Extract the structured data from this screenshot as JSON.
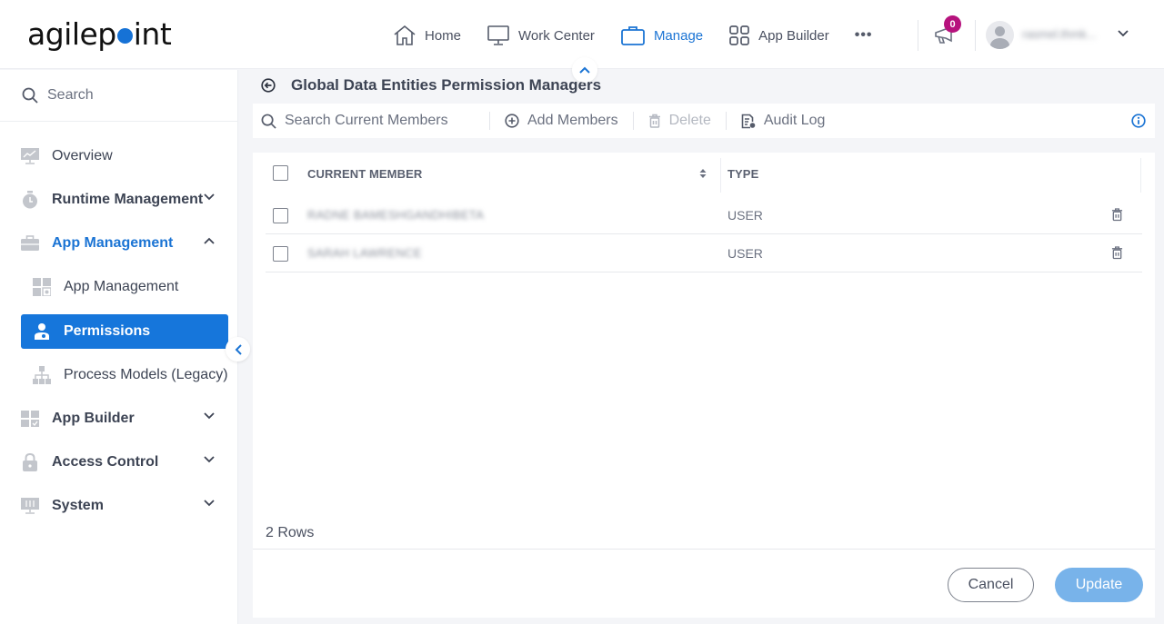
{
  "header": {
    "logo_prefix": "agilep",
    "logo_suffix": "int",
    "nav": [
      {
        "label": "Home",
        "icon": "home-icon",
        "active": false
      },
      {
        "label": "Work Center",
        "icon": "monitor-icon",
        "active": false
      },
      {
        "label": "Manage",
        "icon": "briefcase-icon",
        "active": true
      },
      {
        "label": "App Builder",
        "icon": "grid-icon",
        "active": false
      }
    ],
    "more_label": "•••",
    "notification_count": "0",
    "username": "rasmel.thmk..."
  },
  "sidebar": {
    "search_placeholder": "Search",
    "items": [
      {
        "label": "Overview",
        "icon": "chart-monitor-icon"
      },
      {
        "label": "Runtime Management",
        "icon": "stopwatch-icon",
        "expandable": true,
        "expanded": false
      },
      {
        "label": "App Management",
        "icon": "toolbox-icon",
        "expandable": true,
        "expanded": true
      },
      {
        "label": "App Management",
        "icon": "apps-grid-icon",
        "sub": true
      },
      {
        "label": "Permissions",
        "icon": "user-key-icon",
        "sub": true,
        "selected": true
      },
      {
        "label": "Process Models (Legacy)",
        "icon": "hierarchy-icon",
        "sub": true
      },
      {
        "label": "App Builder",
        "icon": "builder-grid-icon",
        "expandable": true,
        "expanded": false
      },
      {
        "label": "Access Control",
        "icon": "lock-icon",
        "expandable": true,
        "expanded": false
      },
      {
        "label": "System",
        "icon": "system-monitor-icon",
        "expandable": true,
        "expanded": false
      }
    ]
  },
  "page": {
    "title": "Global Data Entities Permission Managers",
    "toolbar": {
      "search_placeholder": "Search Current Members",
      "add_label": "Add Members",
      "delete_label": "Delete",
      "audit_label": "Audit Log"
    },
    "table": {
      "columns": [
        "CURRENT MEMBER",
        "TYPE"
      ],
      "rows": [
        {
          "member": "RADNE BAMESHGANDHIBETA",
          "type": "USER"
        },
        {
          "member": "SARAH LAWRENCE",
          "type": "USER"
        }
      ]
    },
    "row_count": "2 Rows",
    "cancel_label": "Cancel",
    "update_label": "Update"
  },
  "colors": {
    "accent": "#1676db",
    "badge": "#b6127d",
    "update_disabled": "#78b3ea"
  }
}
